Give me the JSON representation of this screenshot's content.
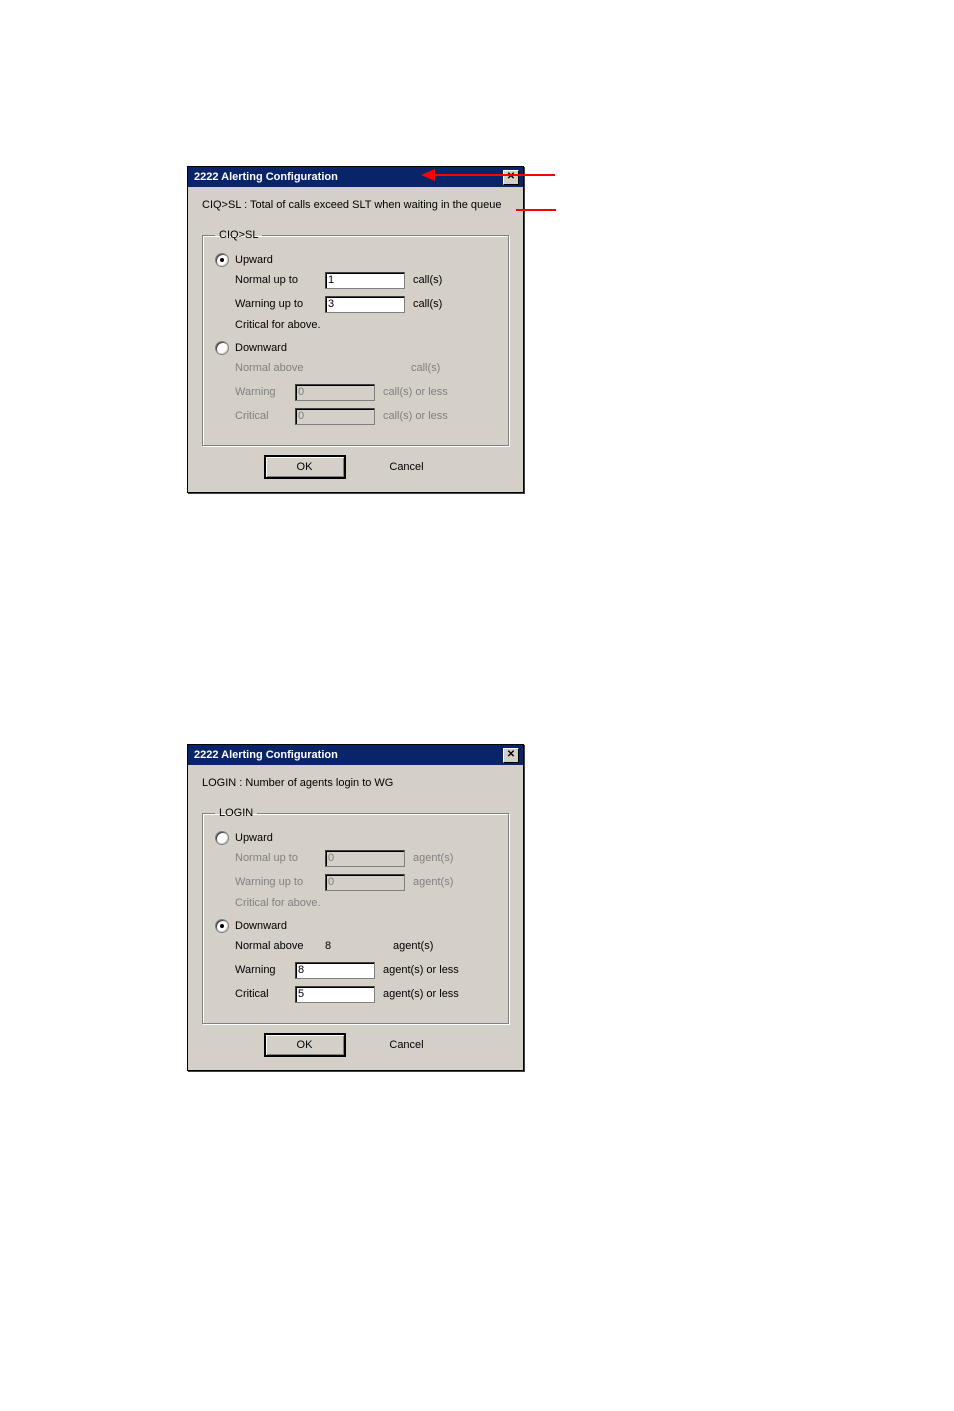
{
  "dialog1": {
    "title": "2222 Alerting Configuration",
    "desc": "CIQ>SL  : Total of calls exceed SLT when waiting in the queue",
    "group_legend": "CIQ>SL",
    "upward": {
      "label": "Upward",
      "selected": true,
      "normal_label": "Normal up to",
      "normal_value": "1",
      "normal_unit": "call(s)",
      "warning_label": "Warning up to",
      "warning_value": "3",
      "warning_unit": "call(s)",
      "critical_label": "Critical for above."
    },
    "downward": {
      "label": "Downward",
      "selected": false,
      "normal_label": "Normal above",
      "normal_value": "",
      "normal_unit": "call(s)",
      "warning_label": "Warning",
      "warning_value": "0",
      "warning_unit": "call(s) or less",
      "critical_label": "Critical",
      "critical_value": "0",
      "critical_unit": "call(s) or less"
    },
    "ok_label": "OK",
    "cancel_label": "Cancel"
  },
  "dialog2": {
    "title": "2222 Alerting Configuration",
    "desc": "LOGIN  : Number of agents login to WG",
    "group_legend": "LOGIN",
    "upward": {
      "label": "Upward",
      "selected": false,
      "normal_label": "Normal up to",
      "normal_value": "0",
      "normal_unit": "agent(s)",
      "warning_label": "Warning up to",
      "warning_value": "0",
      "warning_unit": "agent(s)",
      "critical_label": "Critical for above."
    },
    "downward": {
      "label": "Downward",
      "selected": true,
      "normal_label": "Normal above",
      "normal_value": "8",
      "normal_unit": "agent(s)",
      "warning_label": "Warning",
      "warning_value": "8",
      "warning_unit": "agent(s) or less",
      "critical_label": "Critical",
      "critical_value": "5",
      "critical_unit": "agent(s) or less"
    },
    "ok_label": "OK",
    "cancel_label": "Cancel"
  }
}
